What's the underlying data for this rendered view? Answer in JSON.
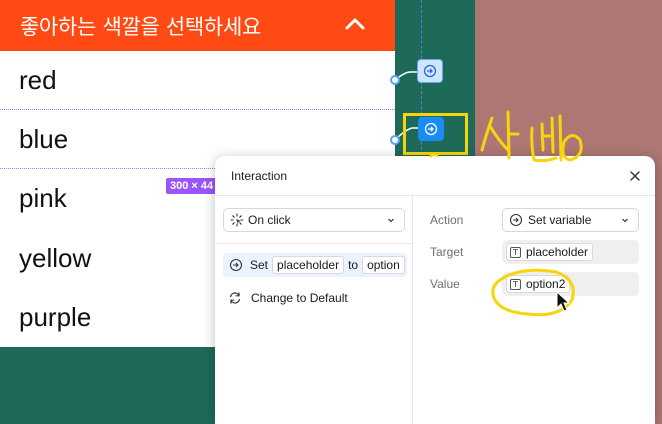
{
  "dropdown": {
    "header": "좋아하는 색깔을 선택하세요",
    "options": [
      "red",
      "blue",
      "pink",
      "yellow",
      "purple"
    ]
  },
  "selection_badge": "300 × 44",
  "panel": {
    "title": "Interaction",
    "trigger": "On click",
    "action_row": {
      "verb": "Set",
      "variable": "placeholder",
      "connector": "to",
      "value": "option"
    },
    "reset_label": "Change to Default",
    "action_label": "Action",
    "action_value": "Set variable",
    "target_label": "Target",
    "target_value": "placeholder",
    "value_label": "Value",
    "value_value": "option2"
  },
  "colors": {
    "header_bg": "#ff4a14",
    "canvas_green": "#1e6a58",
    "canvas_pink": "#ad7773",
    "annotation_yellow": "#f7d50c",
    "node_blue": "#1c8cf5"
  }
}
